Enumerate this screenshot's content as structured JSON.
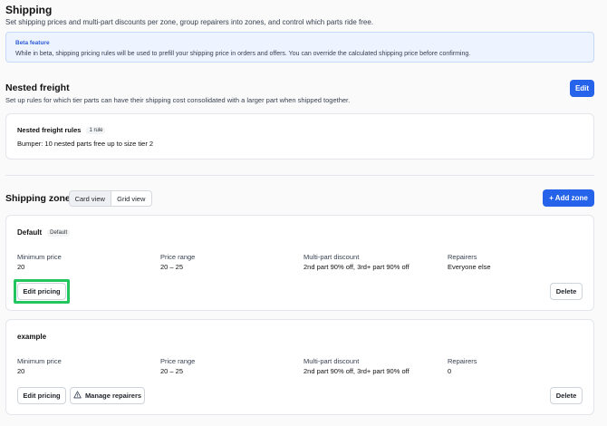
{
  "page": {
    "title": "Shipping",
    "subtitle": "Set shipping prices and multi-part discounts per zone, group repairers into zones, and control which parts ride free."
  },
  "beta": {
    "label": "Beta feature",
    "text": "While in beta, shipping pricing rules will be used to prefill your shipping price in orders and offers. You can override the calculated shipping price before confirming."
  },
  "nested": {
    "title": "Nested freight",
    "description": "Set up rules for which tier parts can have their shipping cost consolidated with a larger part when shipped together.",
    "edit_label": "Edit",
    "rules_title": "Nested freight rules",
    "rules_count": "1 rule",
    "rule_text": "Bumper: 10 nested parts free up to size tier 2"
  },
  "zones": {
    "title": "Shipping zones",
    "view_options": [
      "Card view",
      "Grid view"
    ],
    "active_view": "Card view",
    "add_label": "+ Add zone",
    "columns": [
      "Minimum price",
      "Price range",
      "Multi-part discount",
      "Repairers"
    ],
    "items": [
      {
        "name": "Default",
        "badge": "Default",
        "min_price": "20",
        "price_range": "20 – 25",
        "discount": "2nd part 90% off, 3rd+ part 90% off",
        "repairers": "Everyone else",
        "edit_label": "Edit pricing",
        "delete_label": "Delete"
      },
      {
        "name": "example",
        "min_price": "20",
        "price_range": "20 – 25",
        "discount": "2nd part 90% off, 3rd+ part 90% off",
        "repairers": "0",
        "edit_label": "Edit pricing",
        "manage_label": "Manage repairers",
        "delete_label": "Delete"
      }
    ]
  },
  "colors": {
    "accent": "#2563eb",
    "highlight": "#22c55e"
  }
}
